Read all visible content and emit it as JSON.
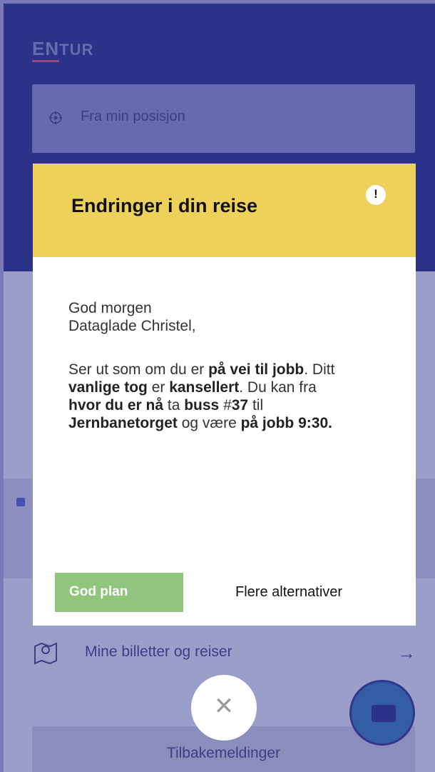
{
  "app": {
    "logo_en": "EN",
    "logo_tur": "TUR",
    "from_field_label": "Fra min posisjon",
    "tickets_label": "Mine billetter og reiser",
    "tickets_arrow": "→",
    "feedback_label": "Tilbakemeldinger"
  },
  "modal": {
    "title": "Endringer i din reise",
    "warning_glyph": "!",
    "greeting_line1": "God morgen",
    "greeting_line2": "Dataglade Christel,",
    "msg": {
      "t1": "Ser ut som om du er ",
      "b1": "på vei til jobb",
      "t2": ". Ditt ",
      "b2": "vanlige tog",
      "t3": " er ",
      "b3": "kansellert",
      "t4": ". Du kan fra ",
      "b4": "hvor du er nå",
      "t5": " ta ",
      "b5": "buss",
      "t6": " #",
      "b6": "37",
      "t7": " til ",
      "b7": "Jernbanetorget",
      "t8": " og være ",
      "b8": "på jobb 9:30."
    },
    "primary_button": "God plan",
    "secondary_button": "Flere alternativer"
  },
  "close_glyph": "✕",
  "colors": {
    "header_bg": "#1f2a7a",
    "modal_header": "#eed15a",
    "primary_button": "#8fc57c",
    "logo_accent": "#e2545d"
  },
  "icons": [
    "location-crosshair-icon",
    "map-pin-icon",
    "arrow-right-icon",
    "ticket-icon",
    "warning-icon",
    "close-icon"
  ]
}
